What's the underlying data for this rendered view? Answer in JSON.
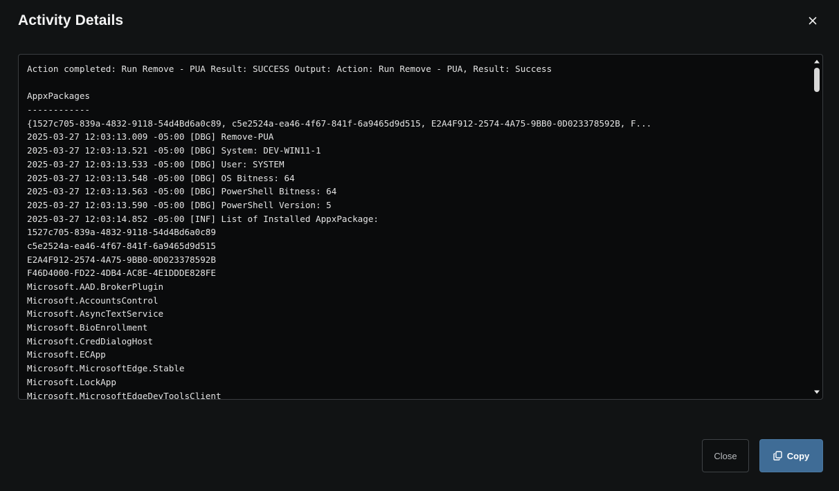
{
  "dialog": {
    "title": "Activity Details",
    "close_icon": "close-icon"
  },
  "log": {
    "lines": [
      "Action completed: Run Remove - PUA Result: SUCCESS Output: Action: Run Remove - PUA, Result: Success",
      "",
      "AppxPackages",
      "------------",
      "{1527c705-839a-4832-9118-54d4Bd6a0c89, c5e2524a-ea46-4f67-841f-6a9465d9d515, E2A4F912-2574-4A75-9BB0-0D023378592B, F...",
      "2025-03-27 12:03:13.009 -05:00 [DBG] Remove-PUA",
      "2025-03-27 12:03:13.521 -05:00 [DBG] System: DEV-WIN11-1",
      "2025-03-27 12:03:13.533 -05:00 [DBG] User: SYSTEM",
      "2025-03-27 12:03:13.548 -05:00 [DBG] OS Bitness: 64",
      "2025-03-27 12:03:13.563 -05:00 [DBG] PowerShell Bitness: 64",
      "2025-03-27 12:03:13.590 -05:00 [DBG] PowerShell Version: 5",
      "2025-03-27 12:03:14.852 -05:00 [INF] List of Installed AppxPackage:",
      "1527c705-839a-4832-9118-54d4Bd6a0c89",
      "c5e2524a-ea46-4f67-841f-6a9465d9d515",
      "E2A4F912-2574-4A75-9BB0-0D023378592B",
      "F46D4000-FD22-4DB4-AC8E-4E1DDDE828FE",
      "Microsoft.AAD.BrokerPlugin",
      "Microsoft.AccountsControl",
      "Microsoft.AsyncTextService",
      "Microsoft.BioEnrollment",
      "Microsoft.CredDialogHost",
      "Microsoft.ECApp",
      "Microsoft.MicrosoftEdge.Stable",
      "Microsoft.LockApp",
      "Microsoft.MicrosoftEdgeDevToolsClient"
    ]
  },
  "footer": {
    "close_label": "Close",
    "copy_label": "Copy",
    "copy_icon": "copy-icon"
  },
  "colors": {
    "background": "#111314",
    "log_background": "#0a0b0c",
    "primary_button": "#3f6c96"
  }
}
